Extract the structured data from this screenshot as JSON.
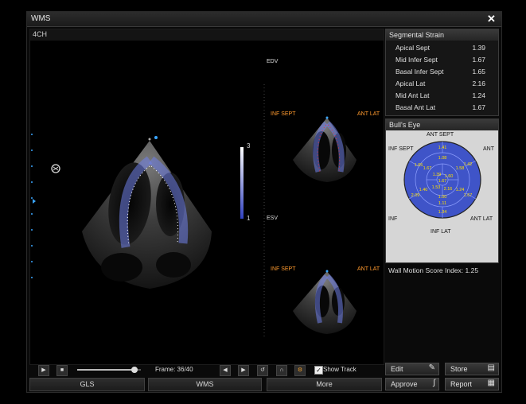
{
  "window": {
    "title": "WMS",
    "close_glyph": "✕"
  },
  "view": {
    "label": "4CH",
    "edv_label": "EDV",
    "esv_label": "ESV",
    "inf_sept": "INF SEPT",
    "ant_lat": "ANT LAT",
    "scale_max": "3",
    "scale_min": "1"
  },
  "strain": {
    "title": "Segmental Strain",
    "rows": [
      {
        "name": "Apical Sept",
        "value": "1.39"
      },
      {
        "name": "Mid Infer Sept",
        "value": "1.67"
      },
      {
        "name": "Basal Infer Sept",
        "value": "1.65"
      },
      {
        "name": "Apical Lat",
        "value": "2.16"
      },
      {
        "name": "Mid Ant Lat",
        "value": "1.24"
      },
      {
        "name": "Basal Ant Lat",
        "value": "1.67"
      }
    ]
  },
  "bullseye": {
    "title": "Bull's Eye",
    "labels": {
      "ant_sept": "ANT SEPT",
      "inf_sept": "INF SEPT",
      "ant": "ANT",
      "inf": "INF",
      "ant_lat": "ANT LAT",
      "inf_lat": "INF LAT"
    },
    "values": [
      "1.41",
      "1.08",
      "1.65",
      "1.67",
      "1.39",
      "1.60",
      "1.58",
      "1.42",
      "1.67",
      "1.53",
      "2.16",
      "1.40",
      "2.09",
      "1.24",
      "1.67",
      "1.00",
      "1.11",
      "1.34"
    ],
    "wmsi": "Wall Motion Score Index: 1.25",
    "fill_color": "#3f54c8"
  },
  "actions": {
    "edit": "Edit",
    "store": "Store",
    "approve": "Approve",
    "report": "Report"
  },
  "controls": {
    "frame": "Frame: 36/40",
    "show_track": "Show Track",
    "slider_fraction": 0.9
  },
  "tabs": {
    "gls": "GLS",
    "wms": "WMS",
    "more": "More"
  }
}
